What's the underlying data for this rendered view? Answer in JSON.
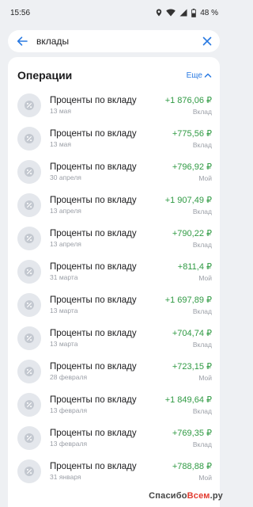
{
  "status_bar": {
    "time": "15:56",
    "battery_text": "48 %",
    "icons": [
      "location-icon",
      "wifi-icon",
      "signal-icon",
      "battery-icon"
    ]
  },
  "search": {
    "value": "вклады",
    "icons": {
      "back": "arrow-left-icon",
      "clear": "close-icon"
    },
    "accent_color": "#2a7ae2"
  },
  "operations": {
    "title": "Операции",
    "more_label": "Еще",
    "items": [
      {
        "title": "Проценты по вкладу",
        "date": "13 мая",
        "amount": "+1 876,06 ₽",
        "account": "Вклад"
      },
      {
        "title": "Проценты по вкладу",
        "date": "13 мая",
        "amount": "+775,56 ₽",
        "account": "Вклад"
      },
      {
        "title": "Проценты по вкладу",
        "date": "30 апреля",
        "amount": "+796,92 ₽",
        "account": "Мой"
      },
      {
        "title": "Проценты по вкладу",
        "date": "13 апреля",
        "amount": "+1 907,49 ₽",
        "account": "Вклад"
      },
      {
        "title": "Проценты по вкладу",
        "date": "13 апреля",
        "amount": "+790,22 ₽",
        "account": "Вклад"
      },
      {
        "title": "Проценты по вкладу",
        "date": "31 марта",
        "amount": "+811,4 ₽",
        "account": "Мой"
      },
      {
        "title": "Проценты по вкладу",
        "date": "13 марта",
        "amount": "+1 697,89 ₽",
        "account": "Вклад"
      },
      {
        "title": "Проценты по вкладу",
        "date": "13 марта",
        "amount": "+704,74 ₽",
        "account": "Вклад"
      },
      {
        "title": "Проценты по вкладу",
        "date": "28 февраля",
        "amount": "+723,15 ₽",
        "account": "Мой"
      },
      {
        "title": "Проценты по вкладу",
        "date": "13 февраля",
        "amount": "+1 849,64 ₽",
        "account": "Вклад"
      },
      {
        "title": "Проценты по вкладу",
        "date": "13 февраля",
        "amount": "+769,35 ₽",
        "account": "Вклад"
      },
      {
        "title": "Проценты по вкладу",
        "date": "31 января",
        "amount": "+788,88 ₽",
        "account": "Мой"
      }
    ],
    "amount_color": "#2f9a43",
    "row_icon": "percent-icon"
  },
  "watermark": {
    "prefix": "Спасибо",
    "accent": "Всем",
    "suffix": ".ру"
  }
}
